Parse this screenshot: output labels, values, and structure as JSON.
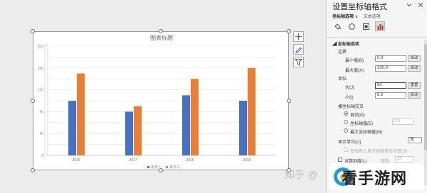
{
  "chart_data": {
    "type": "bar",
    "title": "图表标题",
    "categories": [
      "2016",
      "2017",
      "2018",
      "2019"
    ],
    "series": [
      {
        "name": "系列 1",
        "color": "#4472c4",
        "values": [
          100,
          80,
          110,
          100
        ]
      },
      {
        "name": "系列 2",
        "color": "#ed7d31",
        "values": [
          150,
          90,
          140,
          160
        ]
      }
    ],
    "y_ticks": [
      "200",
      "180",
      "160",
      "140",
      "120",
      "100",
      "80",
      "60",
      "40",
      "20",
      "0"
    ],
    "ylim": [
      0,
      200
    ],
    "grid": true,
    "legend_position": "bottom"
  },
  "chart_tools": {
    "elements_icon": "plus-icon",
    "styles_icon": "brush-icon",
    "filter_icon": "filter-icon"
  },
  "pane": {
    "title": "设置坐标轴格式",
    "dropdown_icon": "chevron-down-icon",
    "close_icon": "close-icon",
    "tab_active": "坐标轴选项",
    "tab_other": "文本选项",
    "section": "坐标轴选项",
    "bounds_label": "边界",
    "min_label": "最小值(B)",
    "min_value": "0.0",
    "min_btn": "自动",
    "max_label": "最大值(X)",
    "max_value": "200.0",
    "max_btn": "自动",
    "units_label": "单位",
    "major_label": "大(J)",
    "major_value": "60",
    "major_btn": "重置",
    "minor_label": "小(I)",
    "minor_value": "8.0",
    "minor_btn": "自动",
    "cross_label": "横坐标轴交叉",
    "cross_auto": "自动(O)",
    "cross_value_label": "坐标轴值(E)",
    "cross_value": "0.0",
    "cross_max": "最大坐标轴值(M)",
    "display_units_label": "显示单位(U)",
    "display_units_value": "无",
    "show_units_label": "在图表上显示刻度单位标签(S)",
    "log_label": "对数刻度(L)",
    "log_base": "10",
    "scale_label": "基数"
  },
  "watermark": {
    "text": "知乎 @",
    "badge": "看手游网"
  }
}
